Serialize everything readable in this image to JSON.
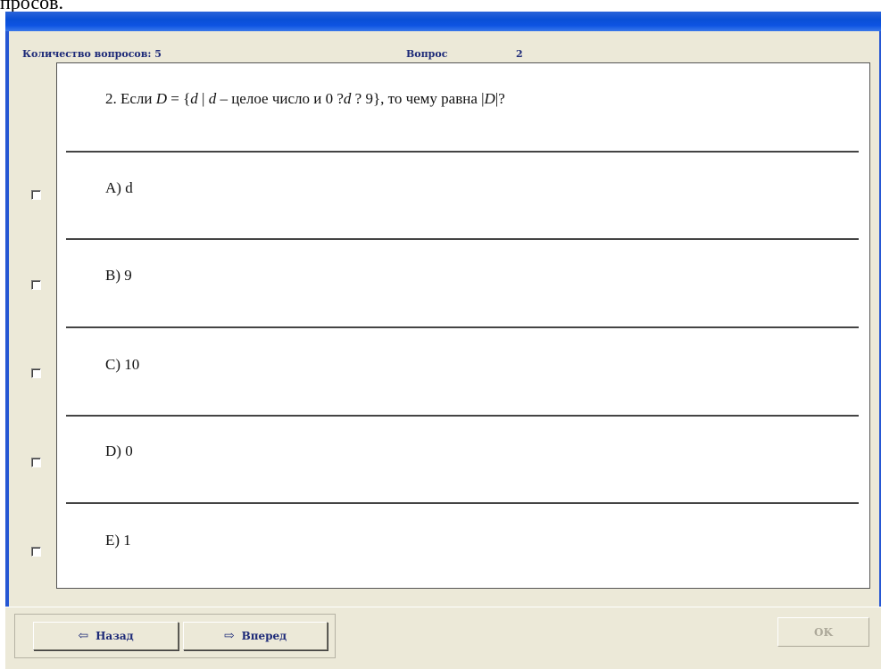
{
  "top_text": "просов.",
  "header": {
    "count_label": "Количество вопросов: 5",
    "question_label": "Вопрос",
    "question_number": "2"
  },
  "question": {
    "number": "2.",
    "prefix": "Если",
    "var_set": "D",
    "eq": "= {",
    "var_d1": "d",
    "sep": "|",
    "var_d2": "d",
    "middle": "– целое число и 0 ?",
    "var_d3": "d",
    "suffix": "? 9}, то чему равна |",
    "var_set2": "D",
    "end": "|?"
  },
  "answers": [
    {
      "label": "A)  d"
    },
    {
      "label": "B)  9"
    },
    {
      "label": "C)  10"
    },
    {
      "label": "D)  0"
    },
    {
      "label": "E)  1"
    }
  ],
  "buttons": {
    "back_label": "Назад",
    "forward_label": "Вперед",
    "ok_label": "OK"
  },
  "colors": {
    "titlebar": "#0a4fd6",
    "window_bg": "#ece9d8",
    "header_text": "#1d2a78"
  }
}
